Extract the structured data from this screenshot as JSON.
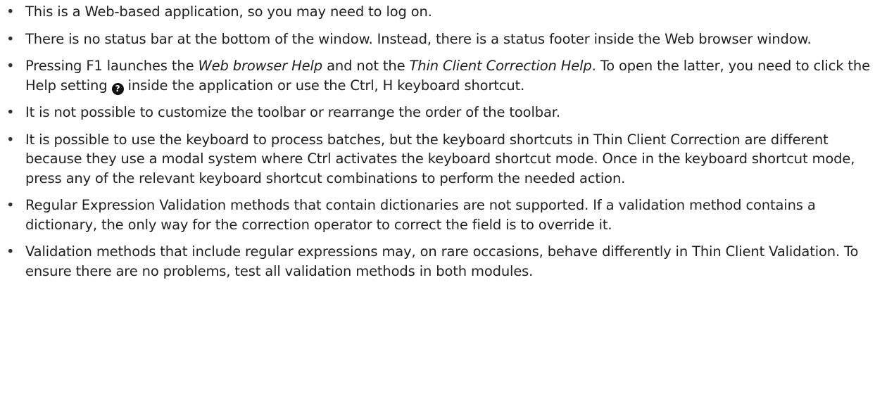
{
  "items": [
    {
      "text": "This is a Web-based application, so you may need to log on."
    },
    {
      "text": "There is no status bar at the bottom of the window. Instead, there is a status footer inside the Web browser window."
    },
    {
      "p1": "Pressing F1 launches the ",
      "em1": "Web browser Help",
      "p2": " and not the ",
      "em2": "Thin Client Correction Help",
      "p3": ". To open the latter, you need to click the Help setting ",
      "icon": "?",
      "p4": " inside the application or use the Ctrl, H keyboard shortcut."
    },
    {
      "text": "It is not possible to customize the toolbar or rearrange the order of the toolbar."
    },
    {
      "text": "It is possible to use the keyboard to process batches, but the keyboard shortcuts in Thin Client Correction are different because they use a modal system where Ctrl activates the keyboard shortcut mode. Once in the keyboard shortcut mode, press any of the relevant keyboard shortcut combinations to perform the needed action."
    },
    {
      "text": "Regular Expression Validation methods that contain dictionaries are not supported. If a validation method contains a dictionary, the only way for the correction operator to correct the field is to override it."
    },
    {
      "text": "Validation methods that include regular expressions may, on rare occasions, behave differently in Thin Client Validation. To ensure there are no problems, test all validation methods in both modules."
    }
  ]
}
